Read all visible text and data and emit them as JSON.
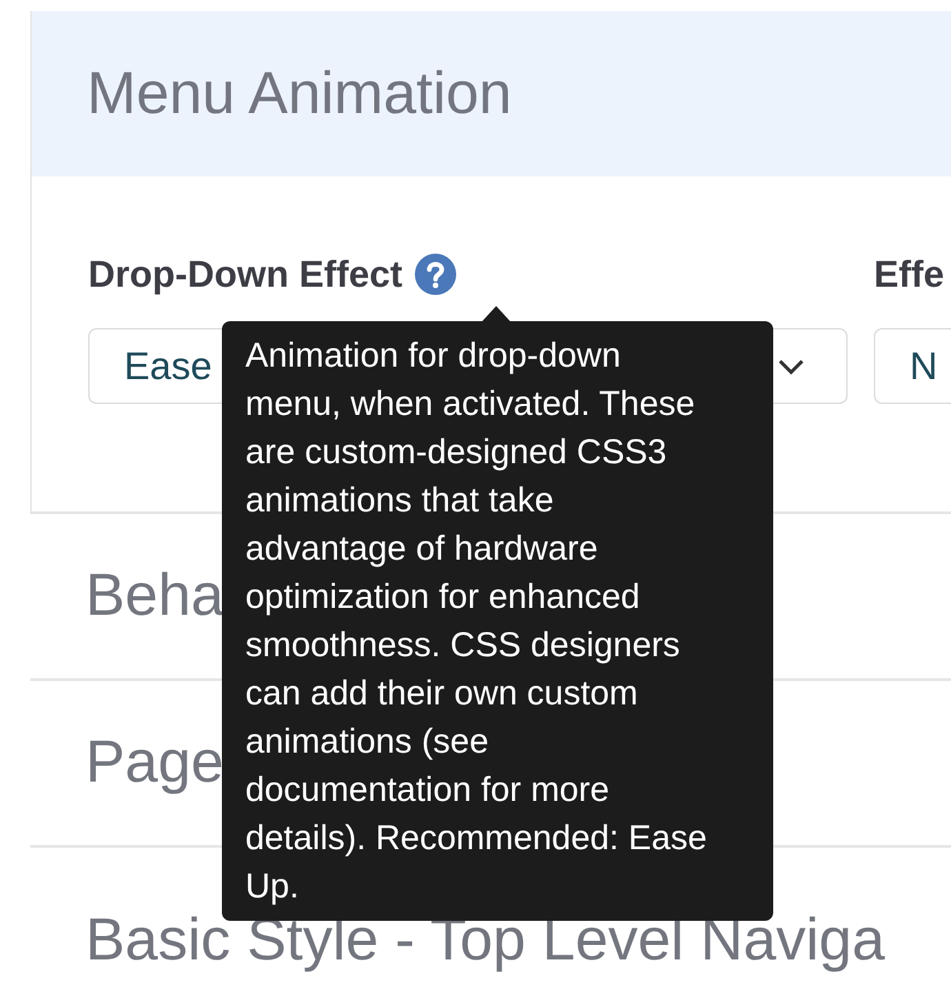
{
  "panel": {
    "title": "Menu Animation",
    "fields": [
      {
        "label": "Drop-Down Effect",
        "help": true,
        "value": "Ease"
      },
      {
        "label": "Effe",
        "help": false,
        "value": "N"
      }
    ]
  },
  "sections": [
    {
      "title": "Beha"
    },
    {
      "title": "Page"
    },
    {
      "title": "Basic Style - Top Level Naviga"
    }
  ],
  "tooltip": {
    "text": "Animation for drop-down menu, when activated. These are custom-designed CSS3 animations that take advantage of hardware optimization for enhanced smoothness. CSS designers can add their own custom animations (see documentation for more details). Recommended: Ease Up."
  }
}
